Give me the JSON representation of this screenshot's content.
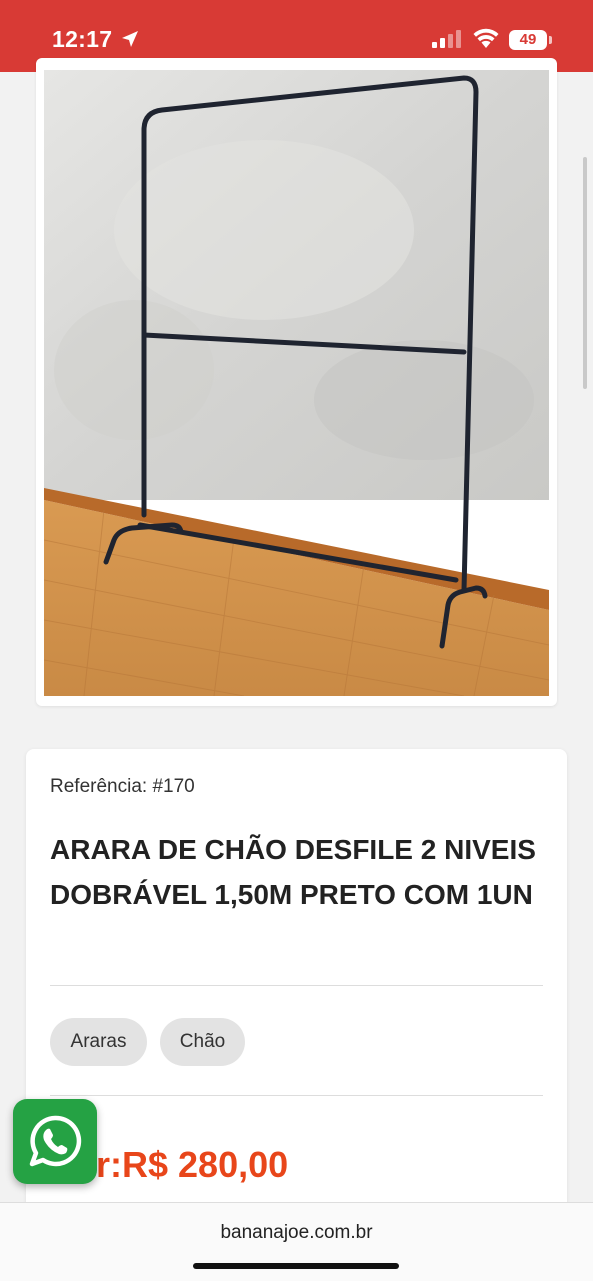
{
  "status_bar": {
    "time": "12:17",
    "battery": "49",
    "icons": [
      "location-arrow-icon",
      "cellular-signal-icon",
      "wifi-icon",
      "battery-icon"
    ],
    "background_color": "#d83a35"
  },
  "product": {
    "image_alt": "clothes-rack-photo",
    "reference": "Referência: #170",
    "title": "ARARA DE CHÃO DESFILE 2 NIVEIS DOBRÁVEL 1,50M PRETO COM 1UN",
    "tags": [
      {
        "label": "Araras"
      },
      {
        "label": "Chão"
      }
    ],
    "price_prefix": "r:",
    "price": "R$ 280,00",
    "price_color": "#e8461a"
  },
  "whatsapp": {
    "icon": "whatsapp-icon",
    "color": "#25a244"
  },
  "browser": {
    "url": "bananajoe.com.br"
  }
}
